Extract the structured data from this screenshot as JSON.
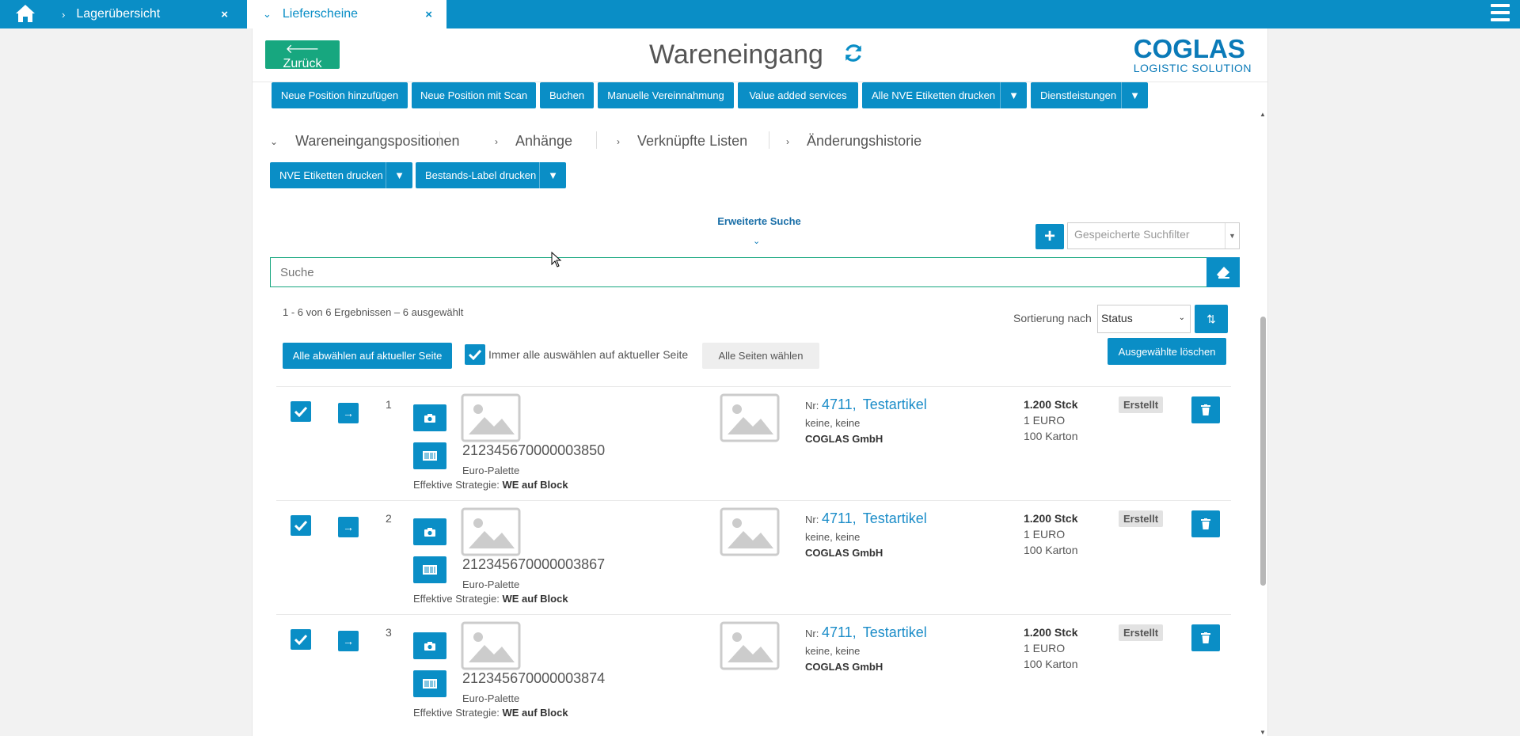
{
  "topbar": {
    "tabs": [
      {
        "label": "Lagerübersicht",
        "active": false
      },
      {
        "label": "Lieferscheine",
        "active": true
      }
    ],
    "close_glyph": "×"
  },
  "header": {
    "back_label": "Zurück",
    "title": "Wareneingang",
    "logo_main": "COGLAS",
    "logo_sub": "LOGISTIC SOLUTION"
  },
  "toolbar": {
    "buttons": [
      "Neue Position hinzufügen",
      "Neue Position mit Scan",
      "Buchen",
      "Manuelle Vereinnahmung",
      "Value added services",
      "Alle NVE Etiketten drucken",
      "Dienstleistungen"
    ]
  },
  "sections": [
    "Wareneingangspositionen",
    "Anhänge",
    "Verknüpfte Listen",
    "Änderungshistorie"
  ],
  "print_buttons": [
    "NVE Etiketten drucken",
    "Bestands-Label drucken"
  ],
  "search": {
    "advanced_label": "Erweiterte Suche",
    "saved_filter_placeholder": "Gespeicherte Suchfilter",
    "placeholder": "Suche"
  },
  "results_info": "1 - 6 von 6 Ergebnissen  –  6 ausgewählt",
  "sort": {
    "label": "Sortierung nach",
    "value": "Status"
  },
  "selection": {
    "deselect_label": "Alle abwählen auf aktueller Seite",
    "always_label": "Immer alle auswählen auf aktueller Seite",
    "all_pages_label": "Alle Seiten wählen",
    "delete_selected_label": "Ausgewählte löschen"
  },
  "rows": [
    {
      "index": "1",
      "nve": "212345670000003850",
      "pallet": "Euro-Palette",
      "strategy_label": "Effektive Strategie:",
      "strategy": "WE auf Block",
      "nr_label": "Nr:",
      "nr": "4711,",
      "article": "Testartikel",
      "desc": "keine, keine",
      "company": "COGLAS GmbH",
      "qty": "1.200 Stck",
      "price": "1 EURO",
      "pack": "100 Karton",
      "status": "Erstellt"
    },
    {
      "index": "2",
      "nve": "212345670000003867",
      "pallet": "Euro-Palette",
      "strategy_label": "Effektive Strategie:",
      "strategy": "WE auf Block",
      "nr_label": "Nr:",
      "nr": "4711,",
      "article": "Testartikel",
      "desc": "keine, keine",
      "company": "COGLAS GmbH",
      "qty": "1.200 Stck",
      "price": "1 EURO",
      "pack": "100 Karton",
      "status": "Erstellt"
    },
    {
      "index": "3",
      "nve": "212345670000003874",
      "pallet": "Euro-Palette",
      "strategy_label": "Effektive Strategie:",
      "strategy": "WE auf Block",
      "nr_label": "Nr:",
      "nr": "4711,",
      "article": "Testartikel",
      "desc": "keine, keine",
      "company": "COGLAS GmbH",
      "qty": "1.200 Stck",
      "price": "1 EURO",
      "pack": "100 Karton",
      "status": "Erstellt"
    }
  ],
  "colors": {
    "primary": "#0a8ec6",
    "success": "#17a77f"
  }
}
